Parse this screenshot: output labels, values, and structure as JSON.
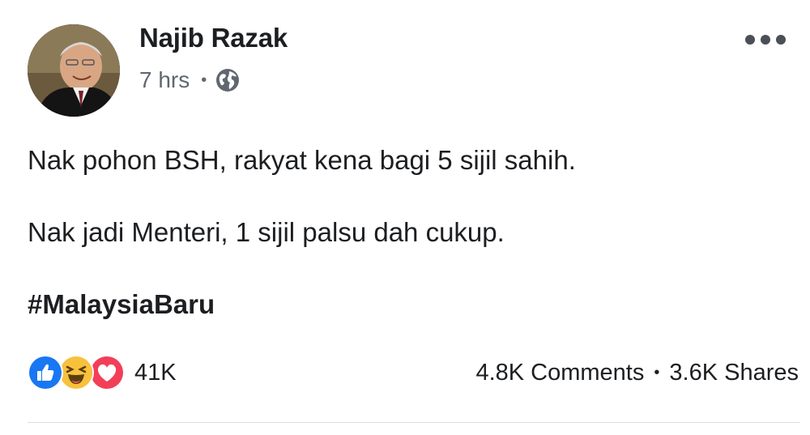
{
  "post": {
    "author": "Najib Razak",
    "timestamp": "7 hrs",
    "meta_separator": "•",
    "privacy_icon": "globe-icon",
    "more_icon": "more-options-icon",
    "lines": [
      "Nak pohon BSH, rakyat kena bagi 5 sijil sahih.",
      "Nak jadi Menteri, 1 sijil palsu dah cukup."
    ],
    "hashtag": "#MalaysiaBaru"
  },
  "reactions": {
    "icons": [
      "like-icon",
      "haha-icon",
      "love-icon"
    ],
    "count": "41K"
  },
  "engagement": {
    "comments": "4.8K Comments",
    "separator": "•",
    "shares": "3.6K Shares"
  },
  "colors": {
    "like": "#1877f2",
    "haha": "#f7c13c",
    "love": "#f33e58",
    "meta_text": "#606770",
    "text": "#1c1e21"
  }
}
